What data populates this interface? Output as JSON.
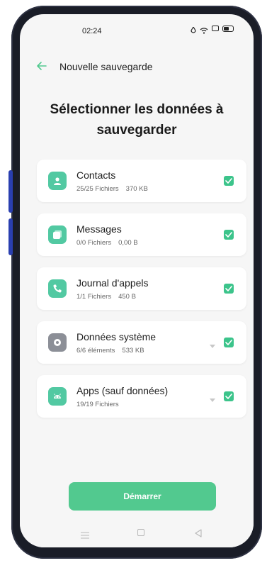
{
  "status": {
    "time": "02:24"
  },
  "header": {
    "title": "Nouvelle sauvegarde"
  },
  "heading": "Sélectionner les données à sauvegarder",
  "items": [
    {
      "name": "Contacts",
      "count": "25/25 Fichiers",
      "size": "370 KB",
      "icon": "contacts-icon",
      "checked": true
    },
    {
      "name": "Messages",
      "count": "0/0 Fichiers",
      "size": "0,00 B",
      "icon": "messages-icon",
      "checked": true
    },
    {
      "name": "Journal d'appels",
      "count": "1/1 Fichiers",
      "size": "450 B",
      "icon": "phone-icon",
      "checked": true
    },
    {
      "name": "Données système",
      "count": "6/6 éléments",
      "size": "533 KB",
      "icon": "settings-icon",
      "checked": true
    },
    {
      "name": "Apps (sauf données)",
      "count": "19/19 Fichiers",
      "size": "",
      "icon": "android-icon",
      "checked": true
    }
  ],
  "start_button": "Démarrer",
  "colors": {
    "accent": "#52c98f",
    "checkbox": "#3cc48b",
    "icon_green": "#52c9a2",
    "icon_gray": "#8c8f97"
  }
}
